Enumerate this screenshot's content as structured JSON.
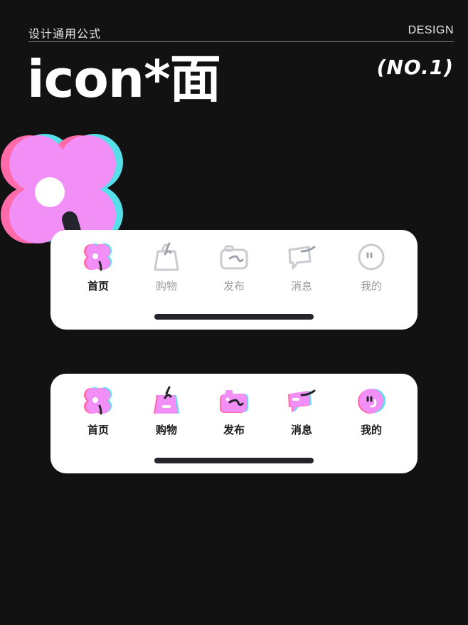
{
  "header": {
    "subtitle": "设计通用公式",
    "brand": "DESIGN",
    "title": "icon*面",
    "issue": "(NO.1)"
  },
  "colors": {
    "background": "#121212",
    "pink": "#f18ff7",
    "hot_pink": "#ff6aa8",
    "cyan": "#56dfe8",
    "stroke_dark": "#24242c",
    "inactive_gray": "#c9cbd1"
  },
  "tabbar_outline": {
    "items": [
      {
        "label": "首页",
        "icon": "flower-icon",
        "active": true
      },
      {
        "label": "购物",
        "icon": "shopping-bag-icon",
        "active": false
      },
      {
        "label": "发布",
        "icon": "camera-icon",
        "active": false
      },
      {
        "label": "消息",
        "icon": "message-bubble-icon",
        "active": false
      },
      {
        "label": "我的",
        "icon": "smiley-face-icon",
        "active": false
      }
    ]
  },
  "tabbar_filled": {
    "items": [
      {
        "label": "首页",
        "icon": "flower-icon"
      },
      {
        "label": "购物",
        "icon": "shopping-bag-icon"
      },
      {
        "label": "发布",
        "icon": "camera-icon"
      },
      {
        "label": "消息",
        "icon": "message-bubble-icon"
      },
      {
        "label": "我的",
        "icon": "smiley-face-icon"
      }
    ]
  }
}
